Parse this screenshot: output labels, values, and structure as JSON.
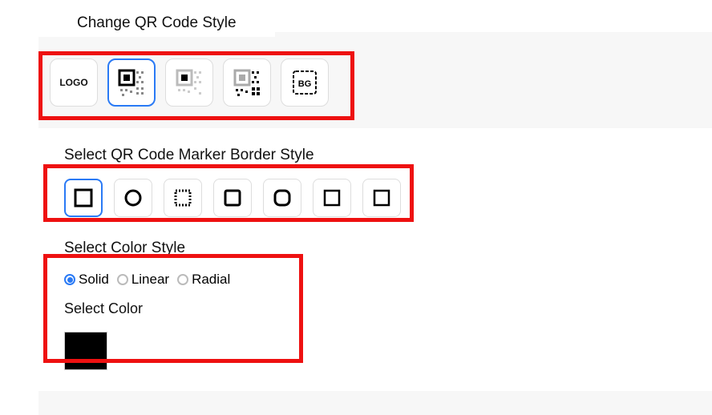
{
  "tab": {
    "label": "Change QR Code Style"
  },
  "style_options": {
    "items": [
      {
        "name": "logo",
        "label": "LOGO",
        "selected": false
      },
      {
        "name": "qr-solid",
        "label": "",
        "selected": true
      },
      {
        "name": "qr-light",
        "label": "",
        "selected": false
      },
      {
        "name": "qr-mixed",
        "label": "",
        "selected": false
      },
      {
        "name": "bg",
        "label": "",
        "selected": false
      }
    ]
  },
  "marker_border": {
    "title": "Select QR Code Marker Border Style",
    "items": [
      "square",
      "circle",
      "dotted",
      "rounded-sq",
      "rounded-rect",
      "thin-sq1",
      "thin-sq2"
    ],
    "selected": 0
  },
  "color_style": {
    "title": "Select Color Style",
    "options": [
      "Solid",
      "Linear",
      "Radial"
    ],
    "selected": 0
  },
  "color": {
    "title": "Select Color",
    "value": "#000000"
  }
}
